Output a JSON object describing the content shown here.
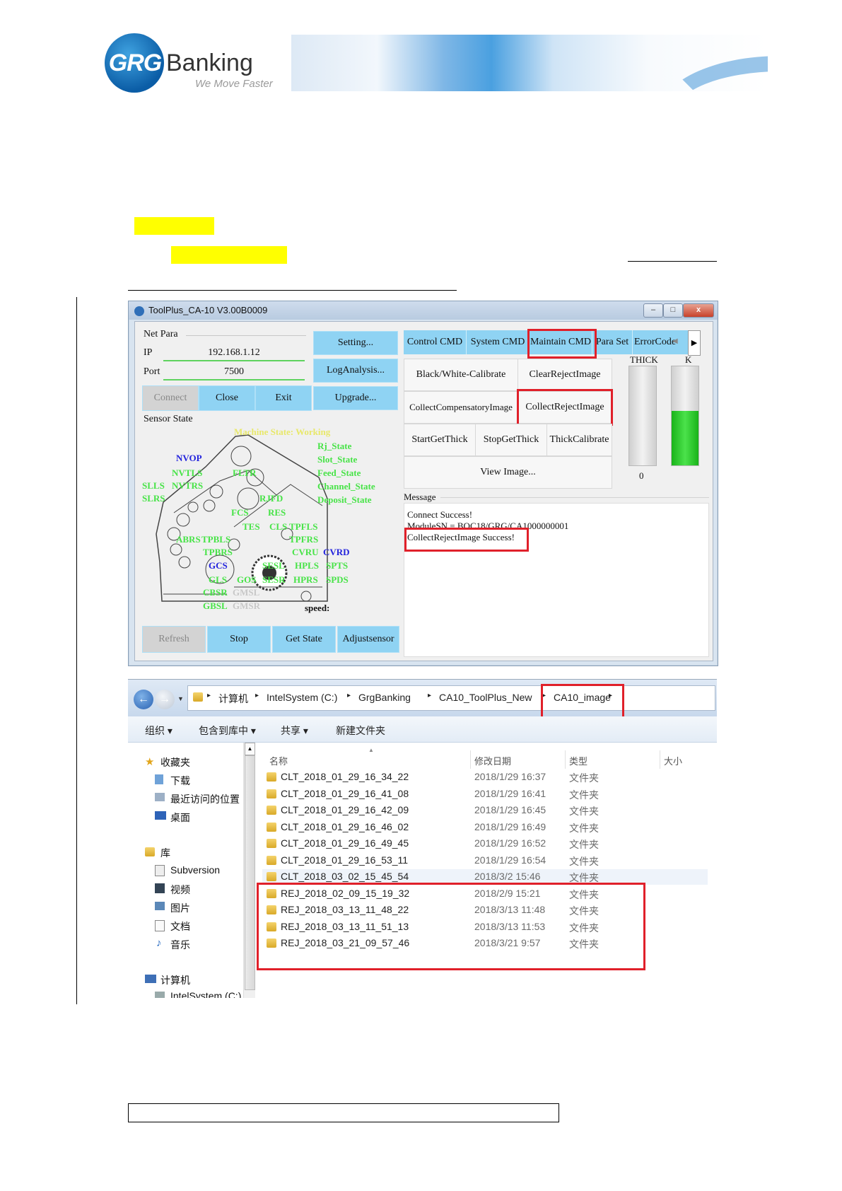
{
  "header": {
    "logo_grg": "GRG",
    "logo_banking": "Banking",
    "logo_tagline": "We Move Faster"
  },
  "toolplus": {
    "title": "ToolPlus_CA-10 V3.00B0009",
    "window_buttons": {
      "minimize": "–",
      "maximize": "□",
      "close": "x"
    },
    "net_para": {
      "group_label": "Net Para",
      "ip_label": "IP",
      "ip_value": "192.168.1.12",
      "port_label": "Port",
      "port_value": "7500"
    },
    "buttons": {
      "connect": "Connect",
      "close": "Close",
      "exit": "Exit",
      "setting": "Setting...",
      "log_analysis": "LogAnalysis...",
      "upgrade": "Upgrade...",
      "refresh": "Refresh",
      "stop": "Stop",
      "get_state": "Get State",
      "adjust_sensor": "Adjustsensor"
    },
    "sensor_state_label": "Sensor State",
    "machine_state": "Machine State: Working",
    "state_list": [
      "Rj_State",
      "Slot_State",
      "Feed_State",
      "Channel_State",
      "Deposit_State"
    ],
    "sensors": {
      "nvop": "NVOP",
      "nvtls": "NVTLS",
      "slls": "SLLS",
      "nvtrs": "NVTRS",
      "slrs": "SLRS",
      "fltr": "FLTR",
      "rjfd": "RJFD",
      "res": "RES",
      "fcs": "FCS",
      "tes": "TES",
      "cls": "CLS",
      "tpfls": "TPFLS",
      "tpfrs": "TPFRS",
      "abrs": "ABRS",
      "tpbls": "TPBLS",
      "tpbrs": "TPBRS",
      "cvru": "CVRU",
      "cvrd": "CVRD",
      "gcs": "GCS",
      "sesl": "SESL",
      "hpls": "HPLS",
      "spts": "SPTS",
      "gls": "GLS",
      "gos": "GOS",
      "sesr": "SESR",
      "hprs": "HPRS",
      "spds": "SPDS",
      "cbsr": "CBSR",
      "gmsl": "GMSL",
      "gbsl": "GBSL",
      "gmsr": "GMSR",
      "speed": "speed:"
    },
    "tabs": [
      "Control CMD",
      "System CMD",
      "Maintain CMD",
      "Para Set",
      "ErrorCode"
    ],
    "commands": {
      "bw_calibrate": "Black/White-Calibrate",
      "clear_reject": "ClearRejectImage",
      "collect_compensatory": "CollectCompensatoryImage",
      "collect_reject": "CollectRejectImage",
      "start_get_thick": "StartGetThick",
      "stop_get_thick": "StopGetThick",
      "thick_calibrate": "ThickCalibrate",
      "view_image": "View Image..."
    },
    "gauges": {
      "thick_label": "THICK",
      "k_label": "K",
      "thick_value": "0",
      "k_level": 0.55
    },
    "message_label": "Message",
    "messages": [
      "Connect Success!",
      "ModuleSN = BOC18/GRG/CA1000000001",
      "CollectRejectImage Success!"
    ]
  },
  "explorer": {
    "breadcrumb": [
      "计算机",
      "IntelSystem (C:)",
      "GrgBanking",
      "CA10_ToolPlus_New",
      "CA10_image"
    ],
    "toolbar": [
      "组织 ▾",
      "包含到库中 ▾",
      "共享 ▾",
      "新建文件夹"
    ],
    "nav": {
      "favorites": "收藏夹",
      "downloads": "下载",
      "recent": "最近访问的位置",
      "desktop": "桌面",
      "libraries": "库",
      "subversion": "Subversion",
      "videos": "视频",
      "pictures": "图片",
      "documents": "文档",
      "music": "音乐",
      "computer": "计算机",
      "drive": "IntelSystem (C:)"
    },
    "columns": [
      "名称",
      "修改日期",
      "类型",
      "大小"
    ],
    "rows": [
      {
        "name": "CLT_2018_01_29_16_34_22",
        "date": "2018/1/29 16:37",
        "type": "文件夹"
      },
      {
        "name": "CLT_2018_01_29_16_41_08",
        "date": "2018/1/29 16:41",
        "type": "文件夹"
      },
      {
        "name": "CLT_2018_01_29_16_42_09",
        "date": "2018/1/29 16:45",
        "type": "文件夹"
      },
      {
        "name": "CLT_2018_01_29_16_46_02",
        "date": "2018/1/29 16:49",
        "type": "文件夹"
      },
      {
        "name": "CLT_2018_01_29_16_49_45",
        "date": "2018/1/29 16:52",
        "type": "文件夹"
      },
      {
        "name": "CLT_2018_01_29_16_53_11",
        "date": "2018/1/29 16:54",
        "type": "文件夹"
      },
      {
        "name": "CLT_2018_03_02_15_45_54",
        "date": "2018/3/2 15:46",
        "type": "文件夹"
      },
      {
        "name": "REJ_2018_02_09_15_19_32",
        "date": "2018/2/9 15:21",
        "type": "文件夹"
      },
      {
        "name": "REJ_2018_03_13_11_48_22",
        "date": "2018/3/13 11:48",
        "type": "文件夹"
      },
      {
        "name": "REJ_2018_03_13_11_51_13",
        "date": "2018/3/13 11:53",
        "type": "文件夹"
      },
      {
        "name": "REJ_2018_03_21_09_57_46",
        "date": "2018/3/21 9:57",
        "type": "文件夹"
      }
    ]
  }
}
